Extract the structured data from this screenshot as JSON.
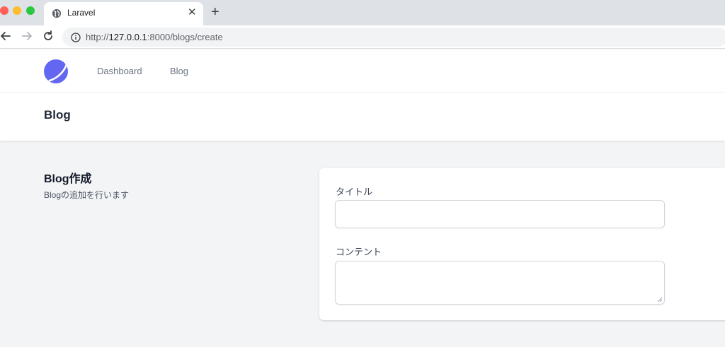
{
  "browser": {
    "tab_title": "Laravel",
    "url_prefix": "http://",
    "url_host": "127.0.0.1",
    "url_path": ":8000/blogs/create"
  },
  "nav": {
    "dashboard": "Dashboard",
    "blog": "Blog"
  },
  "header": {
    "title": "Blog"
  },
  "section": {
    "title": "Blog作成",
    "description": "Blogの追加を行います"
  },
  "form": {
    "title_label": "タイトル",
    "title_value": "",
    "content_label": "コンテント",
    "content_value": ""
  },
  "colors": {
    "accent": "#6366f1",
    "background": "#f3f4f6"
  }
}
